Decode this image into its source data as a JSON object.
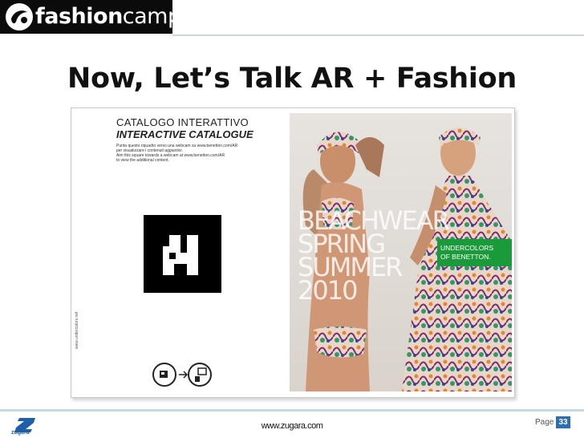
{
  "header": {
    "logo_bold": "fashion",
    "logo_light": "camp",
    "title": "Now, Let’s Talk AR + Fashion"
  },
  "catalogue": {
    "title_it": "CATALOGO INTERATTIVO",
    "title_en": "INTERACTIVE CATALOGUE",
    "line1": "Punta questo riquadro verso una webcam su www.benetton.com/AR",
    "line2": "per visualizzare i contenuti aggiuntivi.",
    "line3": "Aim this square towards a webcam at www.benetton.com/AR",
    "line4": "to view the additional content.",
    "side_url": "www.undercolors.net"
  },
  "ad": {
    "headline": [
      "BEACHWEAR",
      "SPRING",
      "SUMMER",
      "2010"
    ],
    "tag_line1": "UNDERCOLORS",
    "tag_line2": "OF BENETTON.",
    "tag_color": "#1a9a3a"
  },
  "footer": {
    "brand": "zugara",
    "url": "www.zugara.com",
    "page_label": "Page",
    "page_number": "33"
  }
}
